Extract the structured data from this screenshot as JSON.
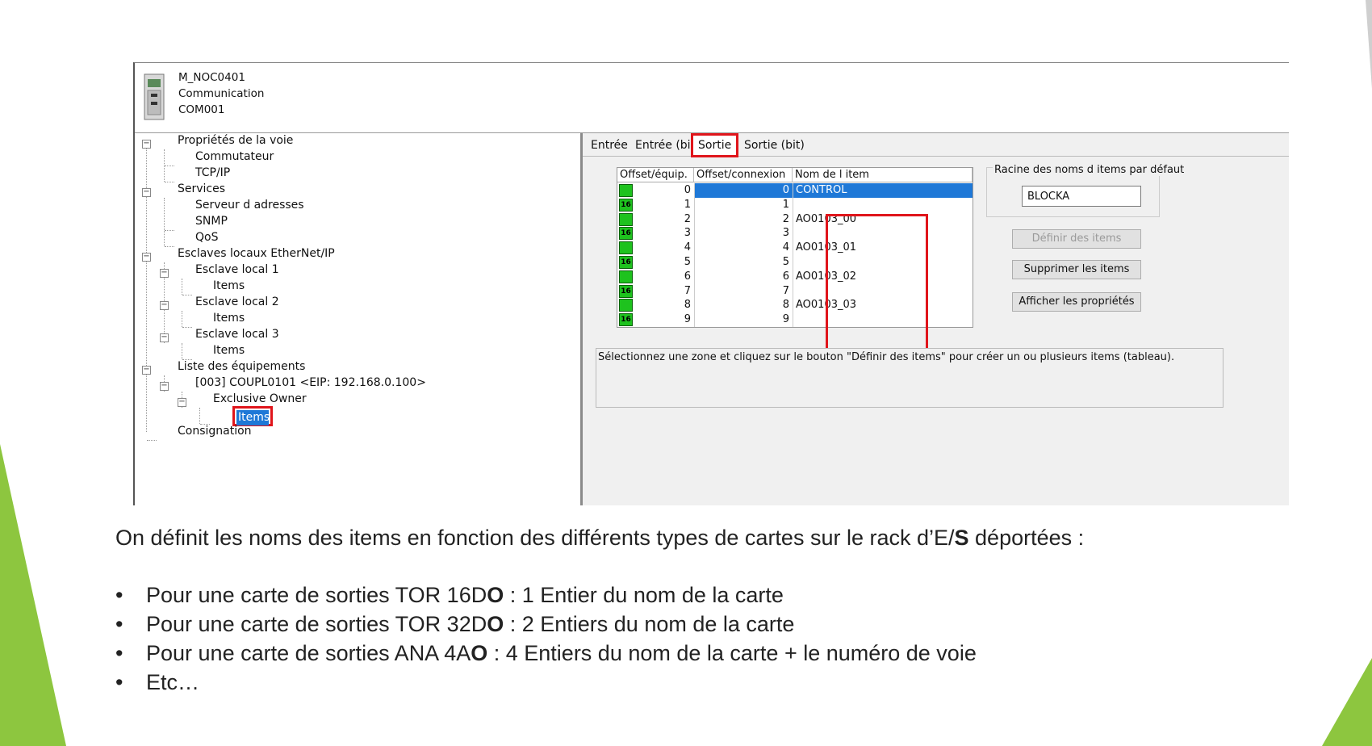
{
  "header": {
    "module_name": "M_NOC0401",
    "module_type": "Communication",
    "module_id": "COM001"
  },
  "tree": {
    "items": [
      {
        "label": "Propriétés de la voie"
      },
      {
        "label": "Commutateur"
      },
      {
        "label": "TCP/IP"
      },
      {
        "label": "Services"
      },
      {
        "label": "Serveur d adresses"
      },
      {
        "label": "SNMP"
      },
      {
        "label": "QoS"
      },
      {
        "label": "Esclaves locaux EtherNet/IP"
      },
      {
        "label": "Esclave local 1"
      },
      {
        "label": "Items"
      },
      {
        "label": "Esclave local 2"
      },
      {
        "label": "Items"
      },
      {
        "label": "Esclave local 3"
      },
      {
        "label": "Items"
      },
      {
        "label": "Liste des équipements"
      },
      {
        "label": "[003] COUPL0101 <EIP: 192.168.0.100>"
      },
      {
        "label": "Exclusive Owner"
      },
      {
        "label": "Items"
      },
      {
        "label": "Consignation"
      }
    ]
  },
  "tabs": [
    "Entrée",
    "Entrée (bit)",
    "Sortie",
    "Sortie (bit)"
  ],
  "active_tab": "Sortie",
  "grid": {
    "headers": [
      "Offset/équip.",
      "Offset/connexion",
      "Nom de l item"
    ],
    "rows": [
      {
        "badge": "",
        "offset_equip": "0",
        "offset_conn": "0",
        "name": "CONTROL"
      },
      {
        "badge": "16",
        "offset_equip": "1",
        "offset_conn": "1",
        "name": ""
      },
      {
        "badge": "",
        "offset_equip": "2",
        "offset_conn": "2",
        "name": "AO0103_00"
      },
      {
        "badge": "16",
        "offset_equip": "3",
        "offset_conn": "3",
        "name": ""
      },
      {
        "badge": "",
        "offset_equip": "4",
        "offset_conn": "4",
        "name": "AO0103_01"
      },
      {
        "badge": "16",
        "offset_equip": "5",
        "offset_conn": "5",
        "name": ""
      },
      {
        "badge": "",
        "offset_equip": "6",
        "offset_conn": "6",
        "name": "AO0103_02"
      },
      {
        "badge": "16",
        "offset_equip": "7",
        "offset_conn": "7",
        "name": ""
      },
      {
        "badge": "",
        "offset_equip": "8",
        "offset_conn": "8",
        "name": "AO0103_03"
      },
      {
        "badge": "16",
        "offset_equip": "9",
        "offset_conn": "9",
        "name": ""
      }
    ]
  },
  "side": {
    "group_label": "Racine des noms d items par défaut",
    "root_value": "BLOCKA",
    "btn_define": "Définir des items",
    "btn_delete": "Supprimer les items",
    "btn_props": "Afficher les propriétés"
  },
  "message": "Sélectionnez une zone et cliquez sur le bouton \"Définir des items\" pour créer un ou plusieurs items (tableau).",
  "slide": {
    "intro_a": "On définit les noms des items en fonction des différents types de cartes sur le rack d’E/",
    "intro_b": "S",
    "intro_c": " déportées :",
    "bullets": [
      {
        "a": "Pour une carte de sorties TOR 16D",
        "b": "O",
        "c": " : 1 Entier du nom de la carte"
      },
      {
        "a": "Pour une carte de sorties TOR 32D",
        "b": "O",
        "c": " : 2 Entiers du nom de la carte"
      },
      {
        "a": "Pour une carte de sorties ANA 4A",
        "b": "O",
        "c": " :  4 Entiers du nom de la carte + le numéro de voie"
      },
      {
        "a": "Etc…",
        "b": "",
        "c": ""
      }
    ],
    "bullet_char": "•"
  },
  "colors": {
    "accent_green": "#8dc63f",
    "selection_blue": "#1e78d7",
    "highlight_red": "#e0151b",
    "status_green": "#1ec21e"
  }
}
